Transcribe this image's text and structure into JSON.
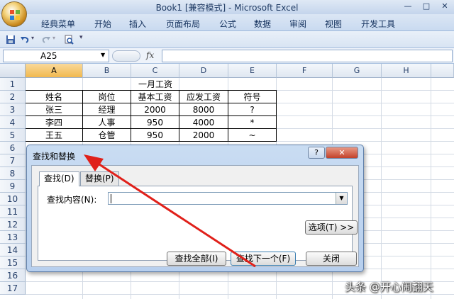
{
  "window": {
    "title": "Book1  [兼容模式] - Microsoft Excel",
    "min": "—",
    "max": "□",
    "close": "✕"
  },
  "ribbon_tabs": [
    "经典菜单",
    "开始",
    "插入",
    "页面布局",
    "公式",
    "数据",
    "审阅",
    "视图",
    "开发工具"
  ],
  "formula_bar": {
    "name_box": "A25",
    "fx": "fx"
  },
  "columns": [
    "A",
    "B",
    "C",
    "D",
    "E",
    "F",
    "G",
    "H"
  ],
  "rows": [
    "1",
    "2",
    "3",
    "4",
    "5",
    "6",
    "7",
    "8",
    "9",
    "10",
    "11",
    "12",
    "13",
    "14",
    "15",
    "16",
    "17"
  ],
  "sheet": {
    "title": "一月工资",
    "headers": [
      "姓名",
      "岗位",
      "基本工资",
      "应发工资",
      "符号"
    ],
    "rows": [
      [
        "张三",
        "经理",
        "2000",
        "8000",
        "?"
      ],
      [
        "李四",
        "人事",
        "950",
        "4000",
        "*"
      ],
      [
        "王五",
        "仓管",
        "950",
        "2000",
        "~"
      ]
    ]
  },
  "dialog": {
    "title": "查找和替换",
    "help": "?",
    "close": "✕",
    "tabs": [
      "查找(D)",
      "替换(P)"
    ],
    "find_label": "查找内容(N):",
    "find_value": "",
    "options_button": "选项(T) >>",
    "find_all_button": "查找全部(I)",
    "find_next_button": "查找下一个(F)",
    "close_button": "关闭"
  },
  "watermark": "头条 @开心闹翻天",
  "colors": {
    "arrow": "#e0201a",
    "selected_header": "#f1b84e"
  }
}
